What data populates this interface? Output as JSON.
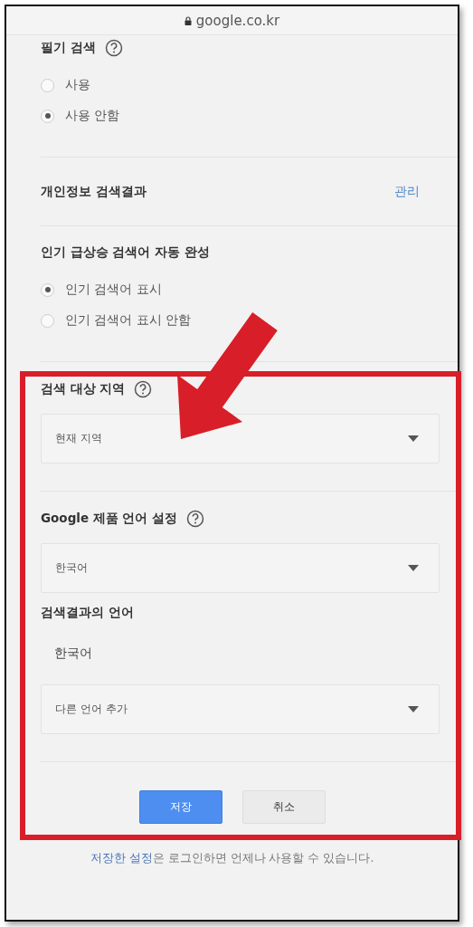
{
  "address_bar": {
    "url": "google.co.kr"
  },
  "sections": [
    {
      "kind": "radio",
      "title": "필기 검색",
      "help": true,
      "divider_after": true,
      "options": [
        {
          "label": "사용",
          "selected": false
        },
        {
          "label": "사용 안함",
          "selected": true
        }
      ]
    },
    {
      "kind": "link",
      "title": "개인정보 검색결과",
      "link": "관리",
      "divider_after": true
    },
    {
      "kind": "radio",
      "title": "인기 급상승 검색어 자동 완성",
      "divider_after": true,
      "options": [
        {
          "label": "인기 검색어 표시",
          "selected": true
        },
        {
          "label": "인기 검색어 표시 안함",
          "selected": false
        }
      ]
    },
    {
      "kind": "select",
      "title": "검색 대상 지역",
      "help": true,
      "value": "현재 지역",
      "divider_after": true
    },
    {
      "kind": "select",
      "title": "Google 제품 언어 설정",
      "help": true,
      "value": "한국어",
      "divider_after": false
    },
    {
      "kind": "languages",
      "title": "검색결과의 언어",
      "languages": [
        "한국어"
      ],
      "add": "다른 언어 추가",
      "divider_after": true
    }
  ],
  "buttons": [
    {
      "label": "저장",
      "kind": "primary"
    },
    {
      "label": "취소",
      "kind": "secondary"
    }
  ],
  "footer": {
    "link": "저장한 설정",
    "text": "은 로그인하면 언제나 사용할 수 있습니다."
  },
  "annotation": {
    "highlight_box": true,
    "arrow": true
  }
}
